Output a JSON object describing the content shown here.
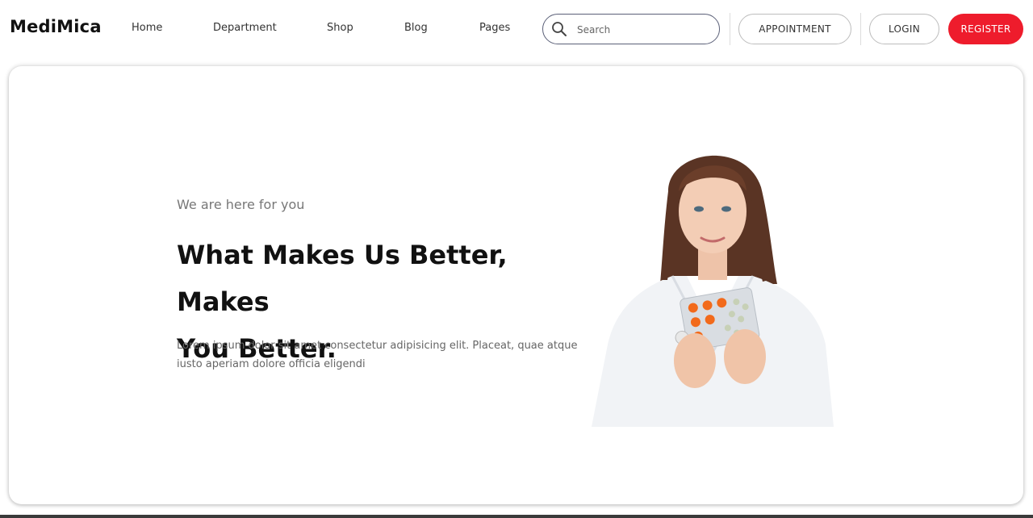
{
  "brand": {
    "name": "MediMica"
  },
  "nav": {
    "items": [
      {
        "label": "Home"
      },
      {
        "label": "Department"
      },
      {
        "label": "Shop"
      },
      {
        "label": "Blog"
      },
      {
        "label": "Pages"
      }
    ]
  },
  "search": {
    "placeholder": "Search",
    "value": ""
  },
  "actions": {
    "appointment_label": "APPOINTMENT",
    "login_label": "LOGIN",
    "register_label": "REGISTER"
  },
  "hero": {
    "eyebrow": "We are here for you",
    "headline_line1": "What Makes Us Better, Makes",
    "headline_line2": "You Better.",
    "body_line1": "Lorem ipsum dolor sit amet consectetur adipisicing elit. Placeat, quae atque",
    "body_line2": "iusto aperiam dolore officia eligendi"
  },
  "colors": {
    "accent": "#ee1c2c",
    "text_dark": "#111111",
    "text_muted": "#777777",
    "pill_orange": "#f26a1b"
  },
  "icons": {
    "search": "search-icon"
  }
}
